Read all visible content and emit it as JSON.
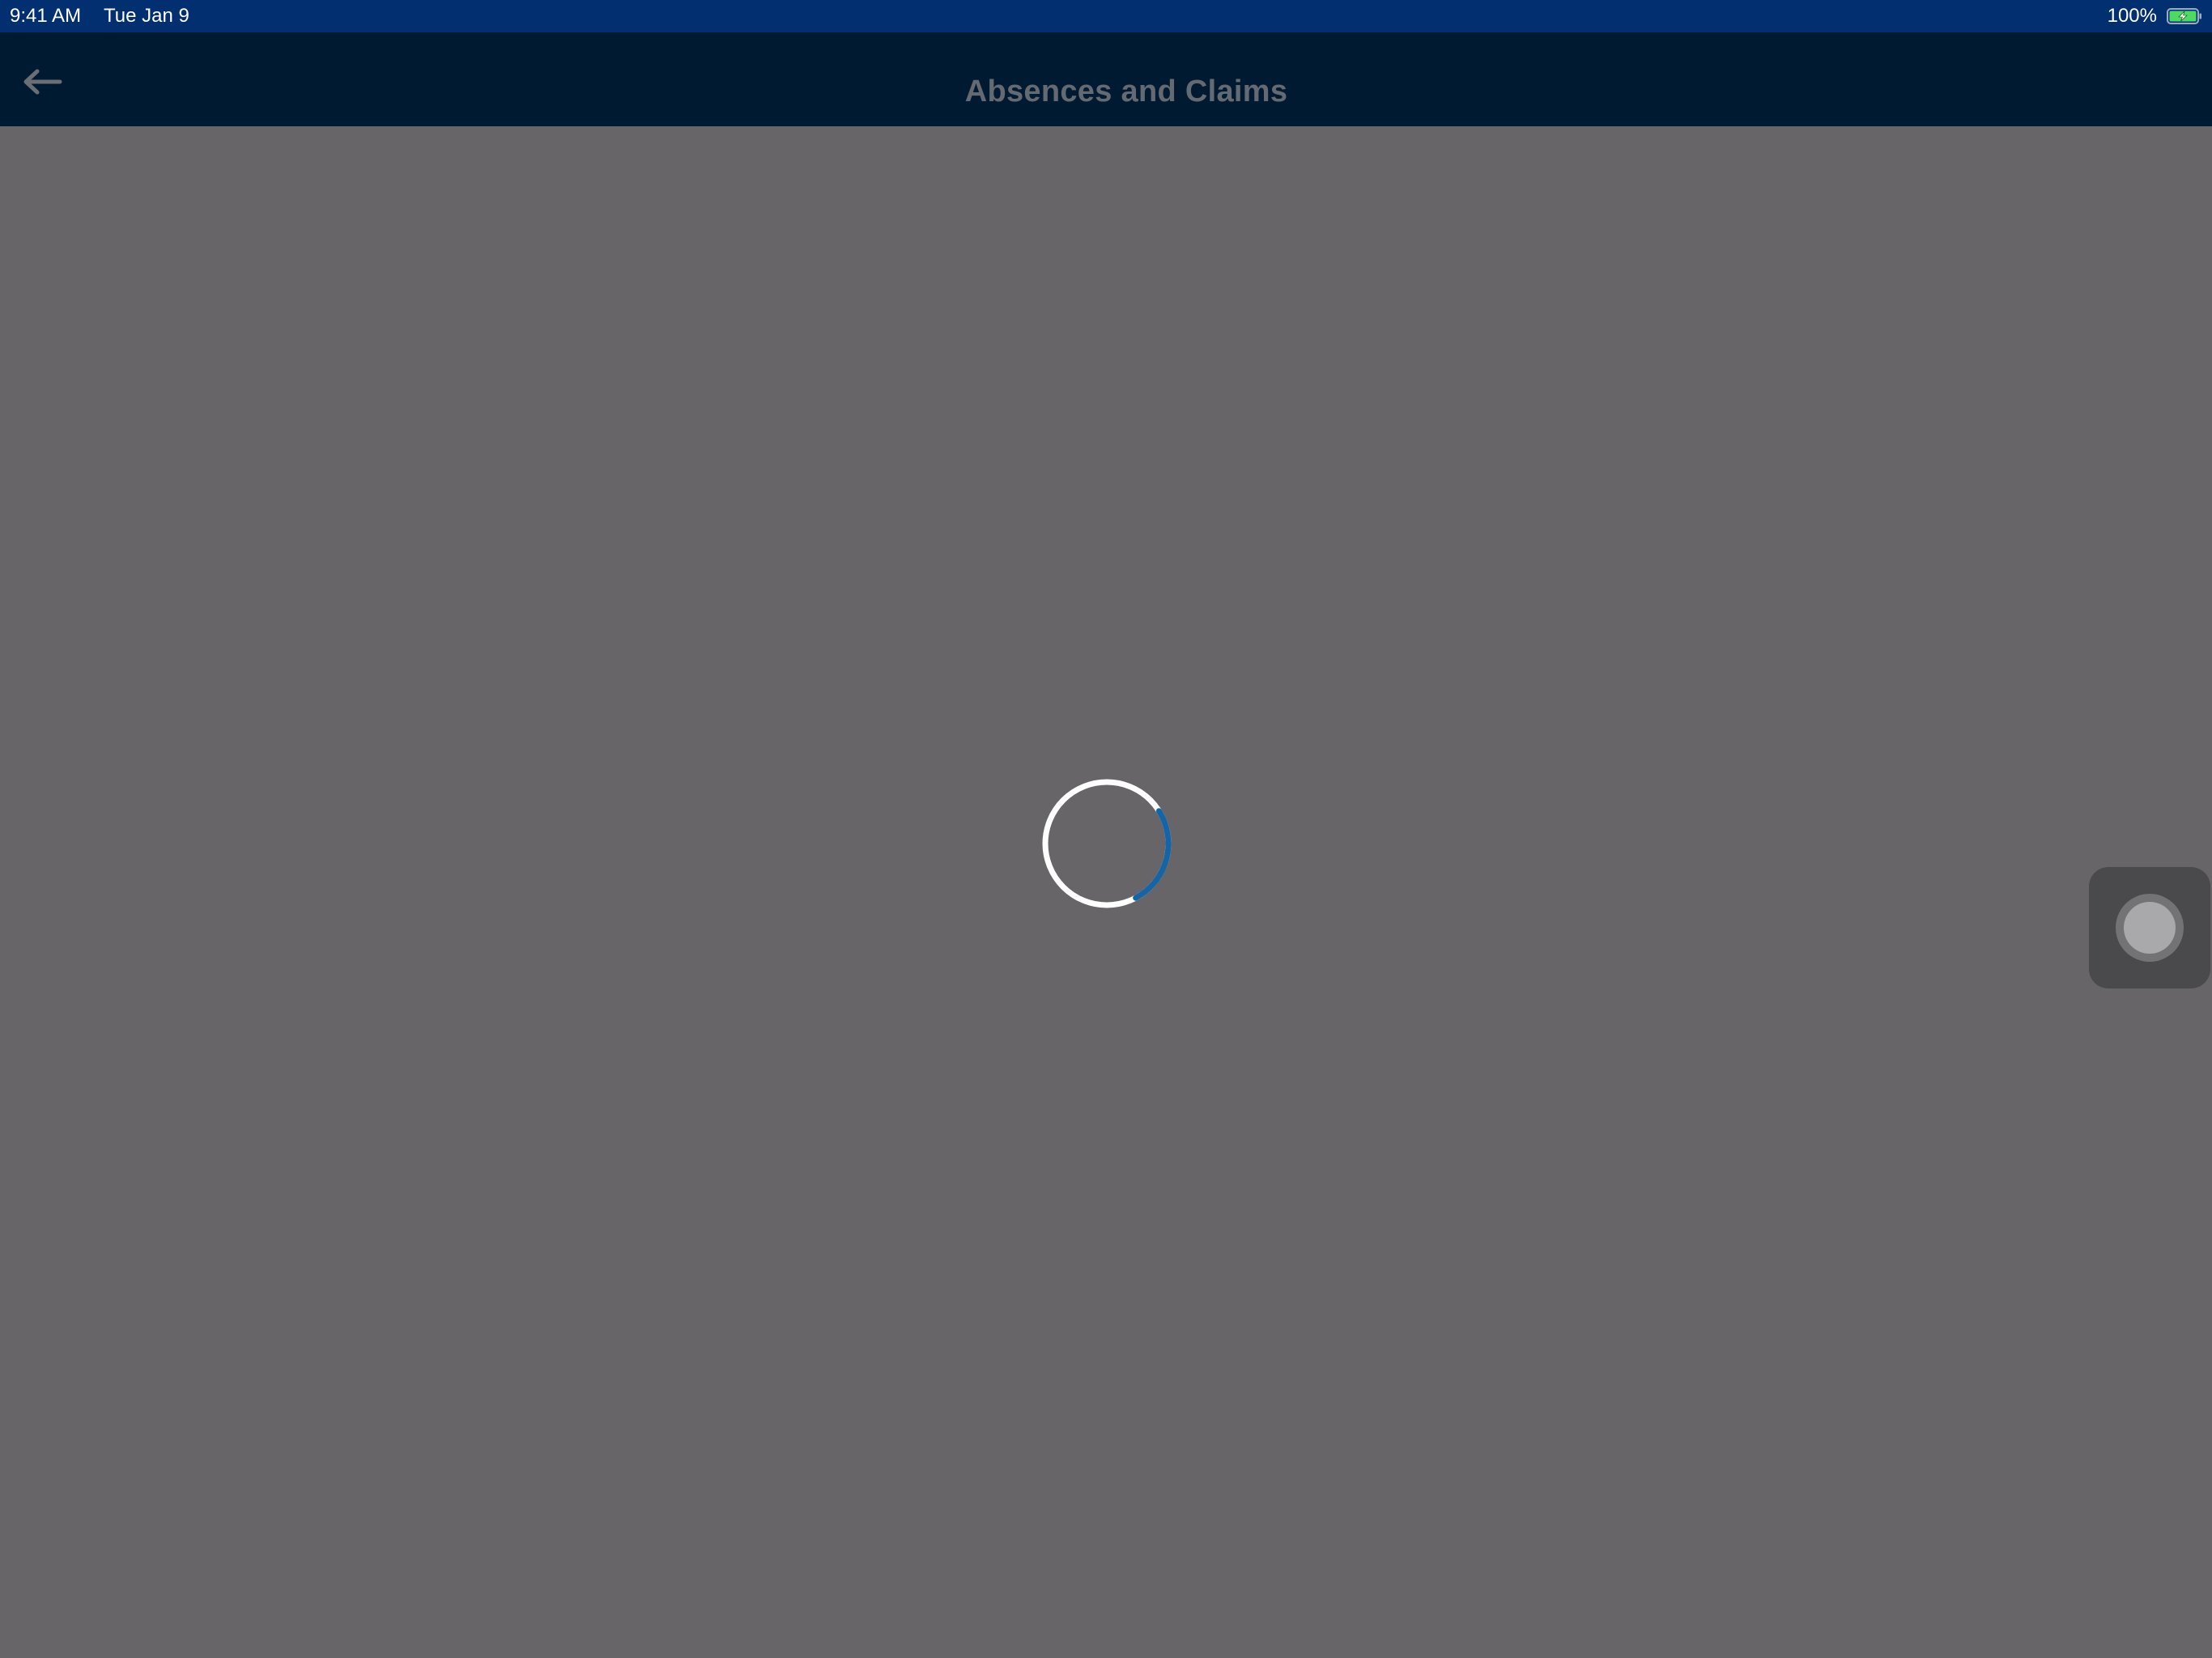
{
  "status_bar": {
    "time": "9:41 AM",
    "date": "Tue Jan 9",
    "battery_percent": "100%",
    "battery_level": 1.0,
    "battery_color": "#4cd964",
    "charging": true
  },
  "header": {
    "title": "Absences and Claims",
    "back_icon": "arrow-left-icon"
  },
  "main": {
    "state": "loading",
    "spinner_icon": "loading-spinner-icon",
    "spinner_accent_color": "#1565a6"
  },
  "assistive_touch": {
    "icon": "assistive-touch-icon"
  },
  "colors": {
    "status_bar_bg": "#022f6f",
    "nav_bar_bg": "#001a31",
    "overlay_bg": "#676568"
  }
}
